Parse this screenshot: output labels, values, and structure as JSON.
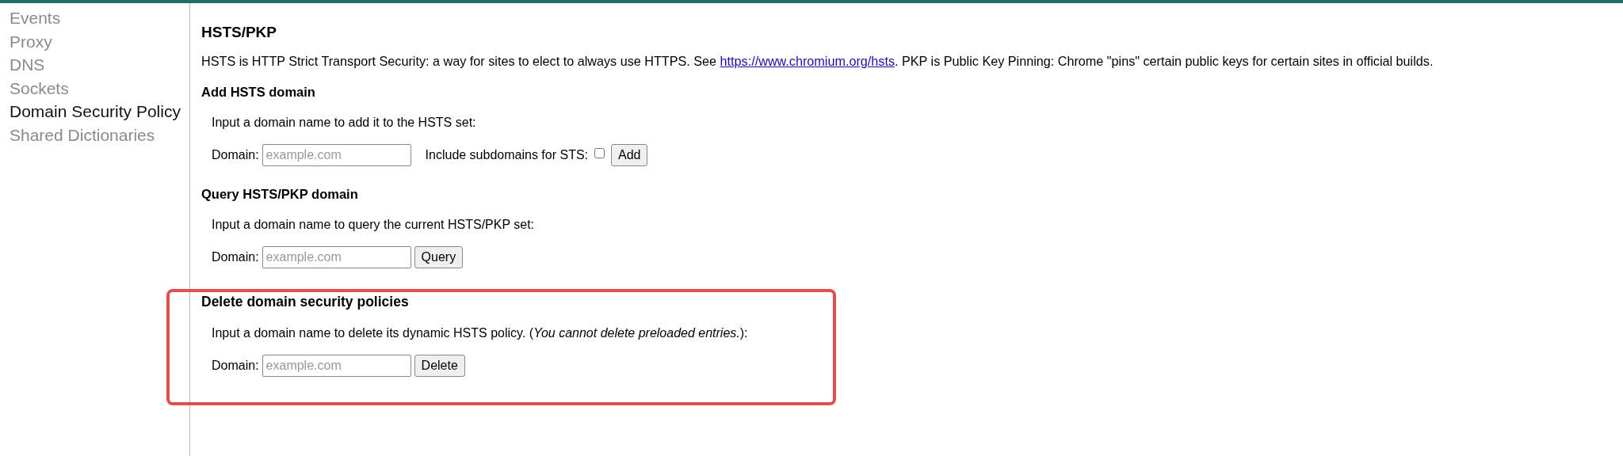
{
  "sidebar": {
    "items": [
      {
        "label": "Events",
        "selected": false
      },
      {
        "label": "Proxy",
        "selected": false
      },
      {
        "label": "DNS",
        "selected": false
      },
      {
        "label": "Sockets",
        "selected": false
      },
      {
        "label": "Domain Security Policy",
        "selected": true
      },
      {
        "label": "Shared Dictionaries",
        "selected": false
      }
    ]
  },
  "page": {
    "title": "HSTS/PKP",
    "intro": {
      "before": "HSTS is HTTP Strict Transport Security: a way for sites to elect to always use HTTPS. See ",
      "link": "https://www.chromium.org/hsts",
      "after": ". PKP is Public Key Pinning: Chrome \"pins\" certain public keys for certain sites in official builds."
    }
  },
  "sections": [
    {
      "title": "Add HSTS domain",
      "description": "Input a domain name to add it to the HSTS set:",
      "field_label": "Domain:",
      "placeholder": "example.com",
      "checkbox": {
        "label": "Include subdomains for STS:",
        "checked": false
      },
      "button": "Add",
      "highlighted": false
    },
    {
      "title": "Query HSTS/PKP domain",
      "description": "Input a domain name to query the current HSTS/PKP set:",
      "field_label": "Domain:",
      "placeholder": "example.com",
      "button": "Query",
      "highlighted": false
    },
    {
      "title": "Delete domain security policies",
      "description": "Input a domain name to delete its dynamic HSTS policy. (*You cannot delete preloaded entries.*):",
      "field_label": "Domain:",
      "placeholder": "example.com",
      "button": "Delete",
      "highlighted": true
    }
  ]
}
